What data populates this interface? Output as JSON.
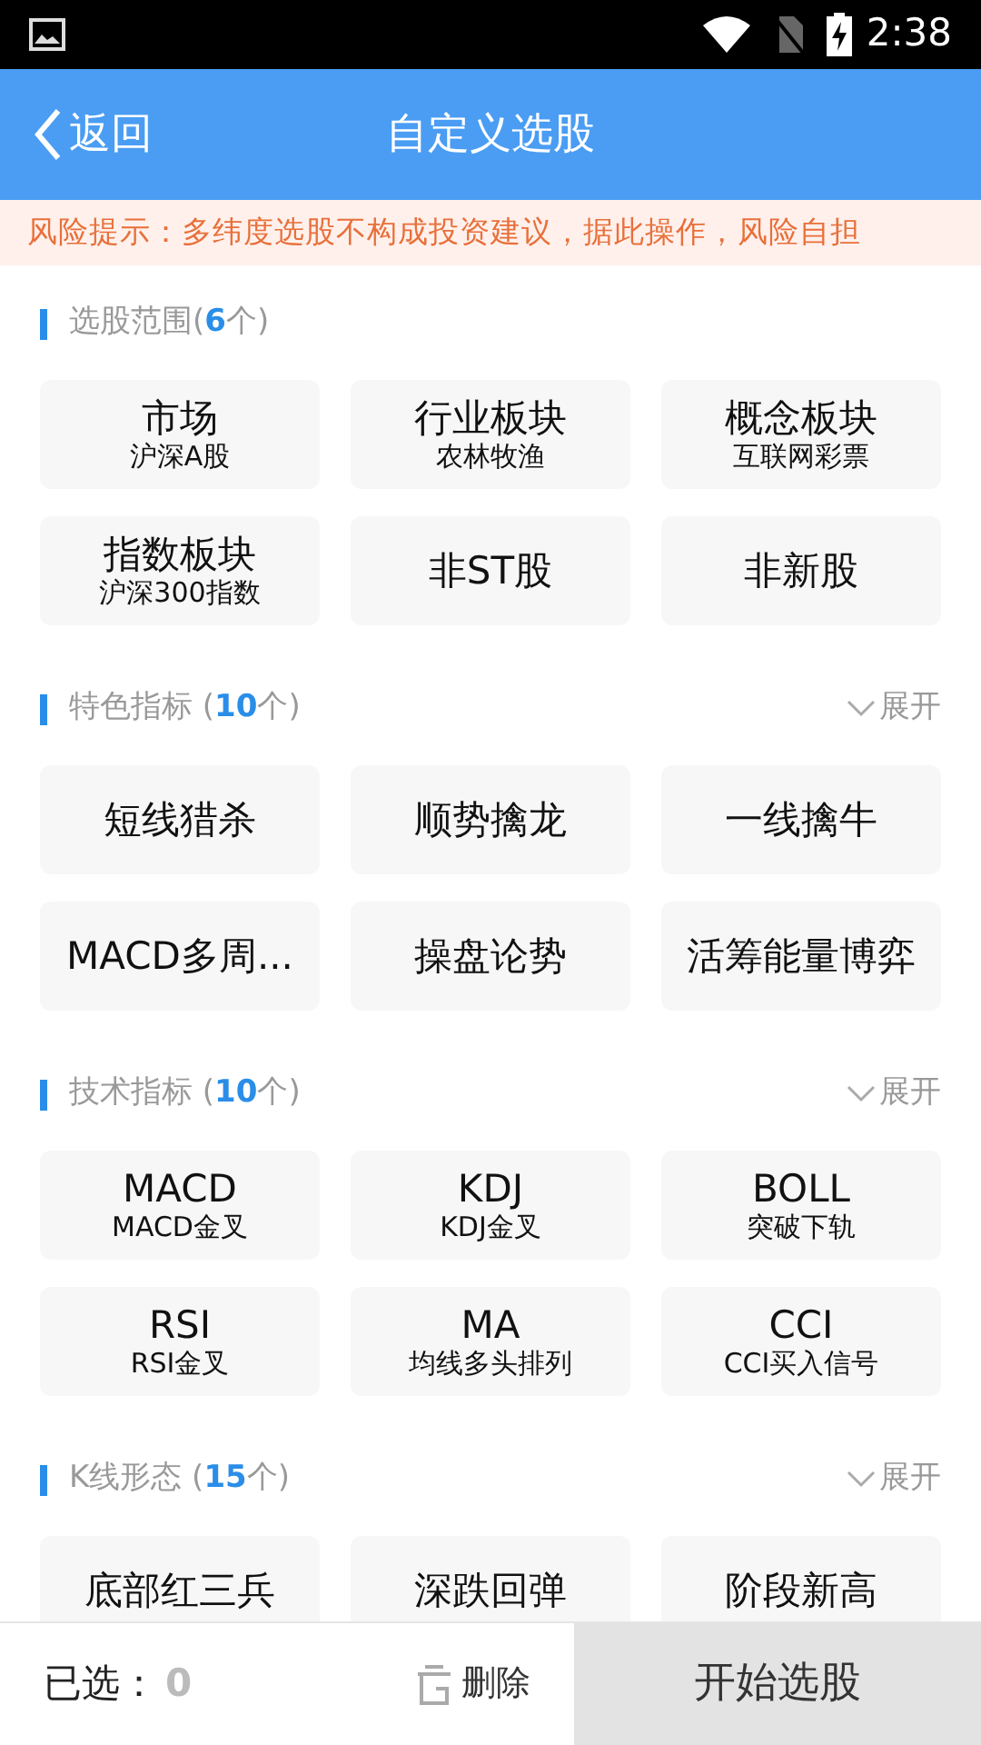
{
  "status_bar": {
    "time": "2:38"
  },
  "header": {
    "back": "返回",
    "title": "自定义选股"
  },
  "risk_notice": "风险提示：多纬度选股不构成投资建议，据此操作，风险自担",
  "sections": [
    {
      "title_prefix": "选股范围(",
      "count": "6",
      "title_suffix": "个)",
      "options": [
        {
          "label": "市场",
          "sub": "沪深A股",
          "selected": false
        },
        {
          "label": "行业板块",
          "sub": "农林牧渔",
          "selected": false
        },
        {
          "label": "概念板块",
          "sub": "互联网彩票",
          "selected": false
        },
        {
          "label": "指数板块",
          "sub": "沪深300指数",
          "selected": false
        },
        {
          "label": "非ST股",
          "selected": false
        },
        {
          "label": "非新股",
          "selected": false
        }
      ]
    },
    {
      "title_prefix": "特色指标 (",
      "count": "10",
      "title_suffix": "个)",
      "toggle": {
        "label": "展开",
        "expanded": false
      },
      "options": [
        {
          "label": "短线猎杀",
          "selected": false
        },
        {
          "label": "顺势擒龙",
          "selected": false
        },
        {
          "label": "一线擒牛",
          "selected": false
        },
        {
          "label": "MACD多周...",
          "selected": false
        },
        {
          "label": "操盘论势",
          "selected": false
        },
        {
          "label": "活筹能量博弈",
          "selected": false
        }
      ]
    },
    {
      "title_prefix": "技术指标 (",
      "count": "10",
      "title_suffix": "个)",
      "toggle": {
        "label": "展开",
        "expanded": false
      },
      "options": [
        {
          "label": "MACD",
          "sub": "MACD金叉",
          "selected": false
        },
        {
          "label": "KDJ",
          "sub": "KDJ金叉",
          "selected": false
        },
        {
          "label": "BOLL",
          "sub": "突破下轨",
          "selected": false
        },
        {
          "label": "RSI",
          "sub": "RSI金叉",
          "selected": false
        },
        {
          "label": "MA",
          "sub": "均线多头排列",
          "selected": false
        },
        {
          "label": "CCI",
          "sub": "CCI买入信号",
          "selected": false
        }
      ]
    },
    {
      "title_prefix": "K线形态 (",
      "count": "15",
      "title_suffix": "个)",
      "toggle": {
        "label": "展开",
        "expanded": false
      },
      "options": [
        {
          "label": "底部红三兵",
          "selected": false
        },
        {
          "label": "深跌回弹",
          "selected": false
        },
        {
          "label": "阶段新高",
          "selected": false
        }
      ]
    }
  ],
  "footer": {
    "selected_label": "已选：",
    "selected_count": "0",
    "delete": "删除",
    "start": "开始选股"
  }
}
